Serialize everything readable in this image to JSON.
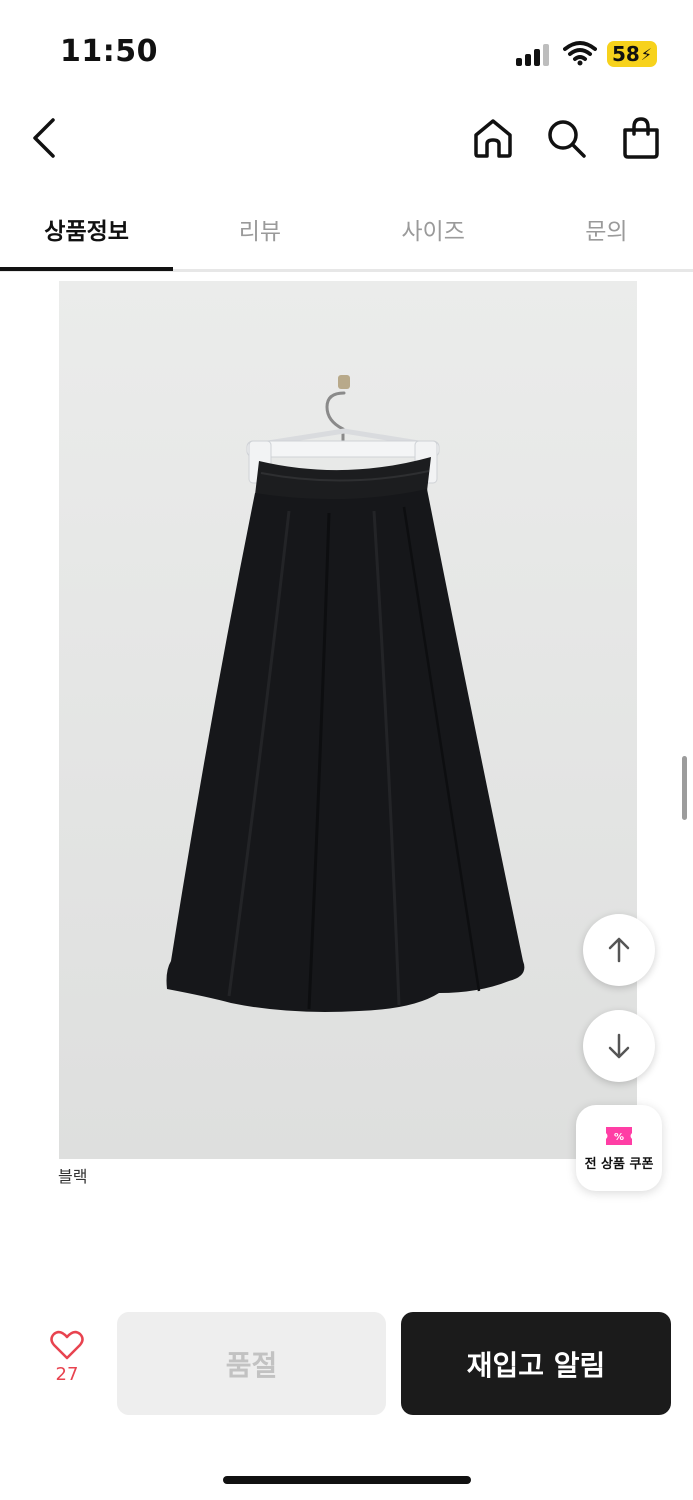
{
  "status_bar": {
    "time": "11:50",
    "battery": "58"
  },
  "nav": {
    "back_icon": "chevron-left-icon",
    "home_icon": "home-icon",
    "search_icon": "search-icon",
    "cart_icon": "shopping-bag-icon"
  },
  "tabs": [
    {
      "label": "상품정보",
      "active": true
    },
    {
      "label": "리뷰",
      "active": false
    },
    {
      "label": "사이즈",
      "active": false
    },
    {
      "label": "문의",
      "active": false
    }
  ],
  "product_image": {
    "caption": "블랙"
  },
  "floating": {
    "scroll_up_icon": "arrow-up-icon",
    "scroll_down_icon": "arrow-down-icon",
    "coupon_label": "전 상품 쿠폰",
    "coupon_icon": "coupon-percent-icon"
  },
  "bottom_bar": {
    "like_count": "27",
    "soldout_label": "품절",
    "restock_label": "재입고 알림"
  },
  "colors": {
    "accent_pink": "#ff3ea5",
    "like_red": "#e8434f",
    "primary_dark": "#1b1b1b",
    "battery_yellow": "#f7d21c"
  }
}
